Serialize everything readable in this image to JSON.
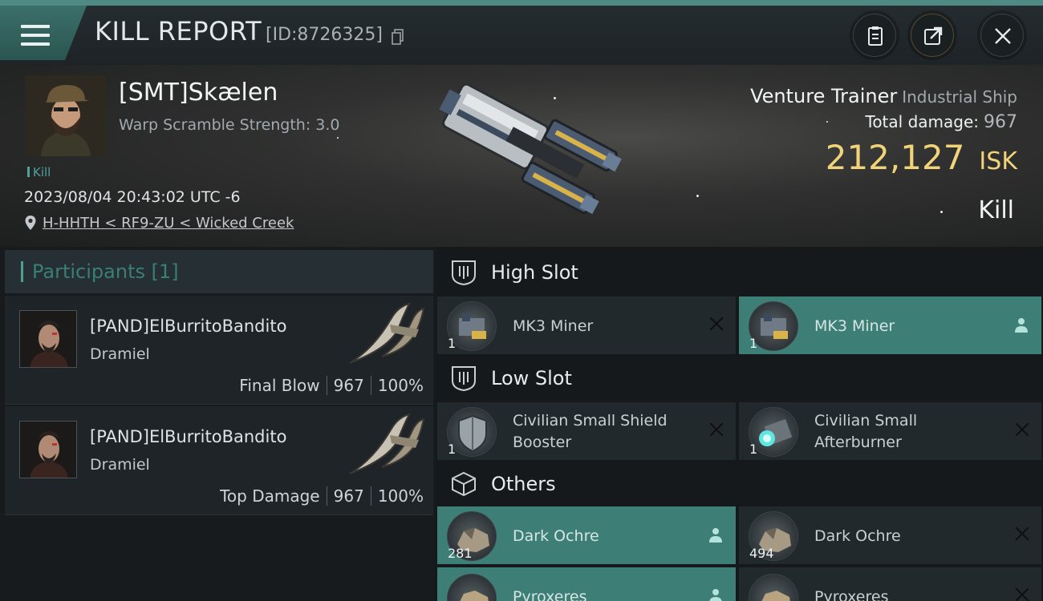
{
  "header": {
    "title": "KILL REPORT",
    "report_id": "[ID:8726325]"
  },
  "victim": {
    "name": "[SMT]Skælen",
    "warp_scramble": "Warp Scramble Strength: 3.0",
    "tag": "Kill",
    "datetime": "2023/08/04 20:43:02 UTC -6",
    "location": "H-HHTH < RF9-ZU < Wicked Creek"
  },
  "ship": {
    "name": "Venture Trainer",
    "class": "Industrial Ship",
    "total_damage_label": "Total damage:",
    "total_damage": "967",
    "isk_value": "212,127",
    "isk_unit": "ISK",
    "result": "Kill"
  },
  "participants": {
    "title": "Participants [1]",
    "rows": [
      {
        "name": "[PAND]ElBurritoBandito",
        "ship": "Dramiel",
        "role": "Final Blow",
        "damage": "967",
        "percent": "100%"
      },
      {
        "name": "[PAND]ElBurritoBandito",
        "ship": "Dramiel",
        "role": "Top Damage",
        "damage": "967",
        "percent": "100%"
      }
    ]
  },
  "slots": {
    "high": {
      "label": "High Slot",
      "items": [
        {
          "name": "MK3 Miner",
          "qty": "1",
          "status": "destroyed"
        },
        {
          "name": "MK3 Miner",
          "qty": "1",
          "status": "dropped"
        }
      ]
    },
    "low": {
      "label": "Low Slot",
      "items": [
        {
          "name_line1": "Civilian Small Shield",
          "name_line2": "Booster",
          "qty": "1",
          "status": "destroyed"
        },
        {
          "name_line1": "Civilian Small",
          "name_line2": "Afterburner",
          "qty": "1",
          "status": "destroyed"
        }
      ]
    },
    "others": {
      "label": "Others",
      "items": [
        {
          "name": "Dark Ochre",
          "qty": "281",
          "status": "dropped"
        },
        {
          "name": "Dark Ochre",
          "qty": "494",
          "status": "destroyed"
        },
        {
          "name": "Pyroxeres",
          "qty": "",
          "status": "dropped"
        },
        {
          "name": "Pyroxeres",
          "qty": "",
          "status": "destroyed"
        }
      ]
    }
  },
  "colors": {
    "accent": "#4f9d95",
    "highlight": "#3d7f77",
    "isk": "#f1d37a"
  }
}
